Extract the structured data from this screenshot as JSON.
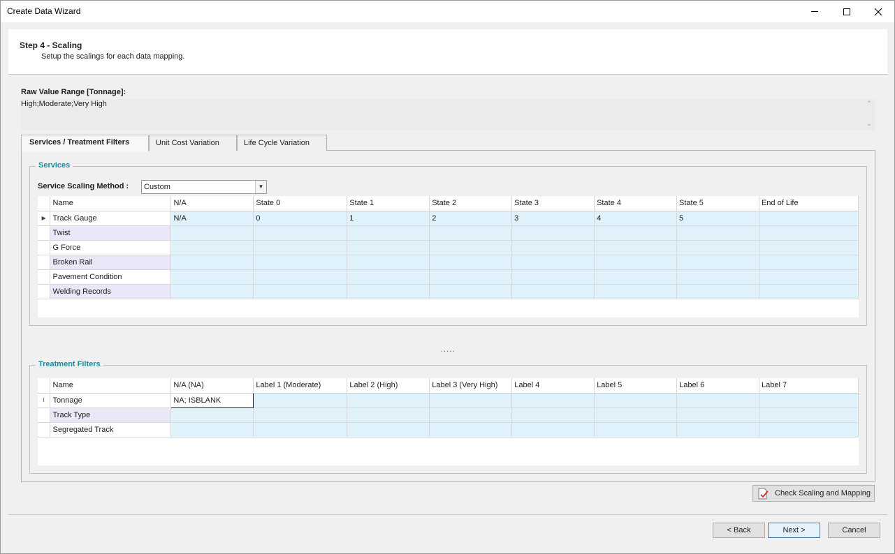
{
  "window": {
    "title": "Create Data Wizard"
  },
  "header": {
    "step_title": "Step 4 - Scaling",
    "step_desc": "Setup the scalings for each data mapping."
  },
  "raw_range": {
    "label": "Raw Value Range [Tonnage]:",
    "value": "High;Moderate;Very High"
  },
  "tabs": [
    {
      "label": "Services / Treatment Filters",
      "active": true
    },
    {
      "label": "Unit Cost Variation",
      "active": false
    },
    {
      "label": "Life Cycle Variation",
      "active": false
    }
  ],
  "services": {
    "caption": "Services",
    "method_label": "Service Scaling Method :",
    "method_value": "Custom",
    "columns": [
      "Name",
      "N/A",
      "State 0",
      "State 1",
      "State 2",
      "State 3",
      "State 4",
      "State 5",
      "End of Life"
    ],
    "rows": [
      {
        "name": "Track Gauge",
        "values": [
          "N/A",
          "0",
          "1",
          "2",
          "3",
          "4",
          "5",
          ""
        ]
      },
      {
        "name": "Twist",
        "values": [
          "",
          "",
          "",
          "",
          "",
          "",
          "",
          ""
        ]
      },
      {
        "name": "G Force",
        "values": [
          "",
          "",
          "",
          "",
          "",
          "",
          "",
          ""
        ]
      },
      {
        "name": "Broken Rail",
        "values": [
          "",
          "",
          "",
          "",
          "",
          "",
          "",
          ""
        ]
      },
      {
        "name": "Pavement Condition",
        "values": [
          "",
          "",
          "",
          "",
          "",
          "",
          "",
          ""
        ]
      },
      {
        "name": "Welding Records",
        "values": [
          "",
          "",
          "",
          "",
          "",
          "",
          "",
          ""
        ]
      }
    ]
  },
  "splitter_text": ".....",
  "treatment": {
    "caption": "Treatment Filters",
    "columns": [
      "Name",
      "N/A (NA)",
      "Label 1 (Moderate)",
      "Label 2 (High)",
      "Label 3 (Very High)",
      "Label 4",
      "Label 5",
      "Label 6",
      "Label 7"
    ],
    "rows": [
      {
        "name": "Tonnage",
        "values": [
          "NA; ISBLANK",
          "",
          "",
          "",
          "",
          "",
          "",
          ""
        ]
      },
      {
        "name": "Track Type",
        "values": [
          "",
          "",
          "",
          "",
          "",
          "",
          "",
          ""
        ]
      },
      {
        "name": "Segregated Track",
        "values": [
          "",
          "",
          "",
          "",
          "",
          "",
          "",
          ""
        ]
      }
    ]
  },
  "buttons": {
    "check": "Check Scaling and Mapping",
    "back": "< Back",
    "next": "Next >",
    "cancel": "Cancel"
  },
  "icons": {
    "row_indicator": "row-pointer-icon",
    "edit_cursor": "text-cursor-icon",
    "check": "document-check-icon"
  }
}
